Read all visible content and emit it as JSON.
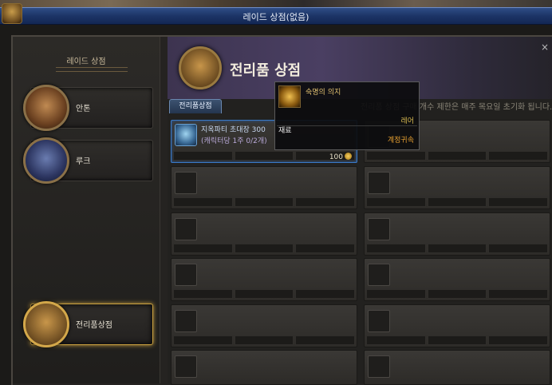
{
  "window": {
    "title": "레이드 상점(없음)",
    "close": "×"
  },
  "sidebar": {
    "title": "레이드 상점",
    "npcs": [
      {
        "label": "안톤"
      },
      {
        "label": "루크"
      },
      {
        "label": "전리품상점"
      }
    ]
  },
  "shop": {
    "title": "전리품 상점",
    "tab": "전리품상점",
    "notice": "전리품 상점 구매 개수 제한은 매주 목요일 초기화 됩니다."
  },
  "item": {
    "name": "지옥파티 초대장 300",
    "limit": "(캐릭터당 1주 0/2개)",
    "price": "100"
  },
  "tooltip": {
    "name": "숙명의 의지",
    "rarity": "레어",
    "type": "재료",
    "binding": "계정귀속"
  },
  "colors": {
    "accent_blue": "#2f4d86",
    "gold": "#c9a040",
    "rare": "#d6b850",
    "bind": "#e8a030"
  }
}
